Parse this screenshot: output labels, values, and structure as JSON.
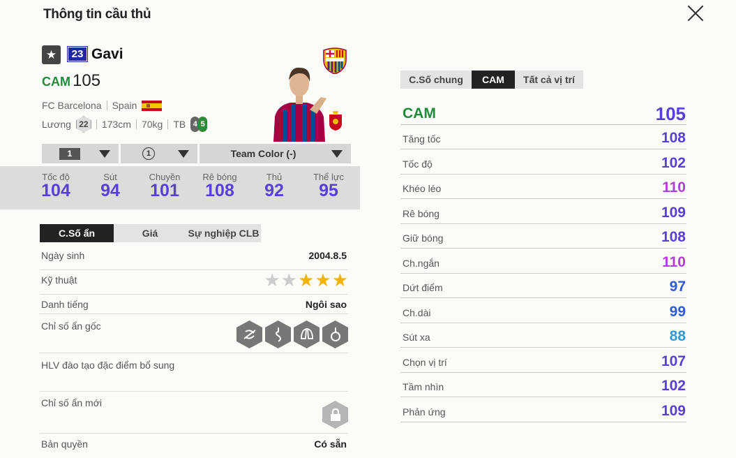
{
  "header": {
    "title": "Thông tin cầu thủ"
  },
  "player": {
    "season": "23",
    "name": "Gavi",
    "position": "CAM",
    "ovr": "105",
    "club": "FC Barcelona",
    "nation": "Spain",
    "salary_label": "Lương",
    "salary": "22",
    "height": "173cm",
    "weight": "70kg",
    "body": "TB",
    "weak_foot": "4",
    "strong_foot": "5"
  },
  "selectors": {
    "level": "1",
    "team_color": "Team Color (-)",
    "circle": "1"
  },
  "summary": [
    {
      "label": "Tốc độ",
      "value": "104"
    },
    {
      "label": "Sút",
      "value": "94"
    },
    {
      "label": "Chuyền",
      "value": "101"
    },
    {
      "label": "Rê bóng",
      "value": "108"
    },
    {
      "label": "Thủ",
      "value": "92"
    },
    {
      "label": "Thể lực",
      "value": "95"
    }
  ],
  "info_tabs": [
    "C.Số ẩn",
    "Giá",
    "Sự nghiệp CLB"
  ],
  "info": {
    "birth_label": "Ngày sinh",
    "birth": "2004.8.5",
    "skill_label": "Kỹ thuật",
    "skill_stars": 3,
    "fame_label": "Danh tiếng",
    "fame": "Ngôi sao",
    "traits_label": "Chỉ số ẩn gốc",
    "coach_label": "HLV đào tạo đặc điểm bổ sung",
    "new_label": "Chỉ số ẩn mới",
    "license_label": "Bản quyền",
    "license": "Có sẵn"
  },
  "stat_tabs": [
    "C.Số chung",
    "CAM",
    "Tất cả vị trí"
  ],
  "stats_header": {
    "label": "CAM",
    "value": "105"
  },
  "stats": [
    {
      "label": "Tăng tốc",
      "value": "108",
      "color": "#5a3fd6"
    },
    {
      "label": "Tốc độ",
      "value": "102",
      "color": "#5a3fd6"
    },
    {
      "label": "Khéo léo",
      "value": "110",
      "color": "#b23fd6"
    },
    {
      "label": "Rê bóng",
      "value": "109",
      "color": "#5a3fd6"
    },
    {
      "label": "Giữ bóng",
      "value": "108",
      "color": "#5a3fd6"
    },
    {
      "label": "Ch.ngắn",
      "value": "110",
      "color": "#b23fd6"
    },
    {
      "label": "Dứt điểm",
      "value": "97",
      "color": "#2f5bd6"
    },
    {
      "label": "Ch.dài",
      "value": "99",
      "color": "#2f5bd6"
    },
    {
      "label": "Sút xa",
      "value": "88",
      "color": "#2f9bd6"
    },
    {
      "label": "Chọn vị trí",
      "value": "107",
      "color": "#5a3fd6"
    },
    {
      "label": "Tầm nhìn",
      "value": "102",
      "color": "#5a3fd6"
    },
    {
      "label": "Phản ứng",
      "value": "109",
      "color": "#5a3fd6"
    }
  ]
}
